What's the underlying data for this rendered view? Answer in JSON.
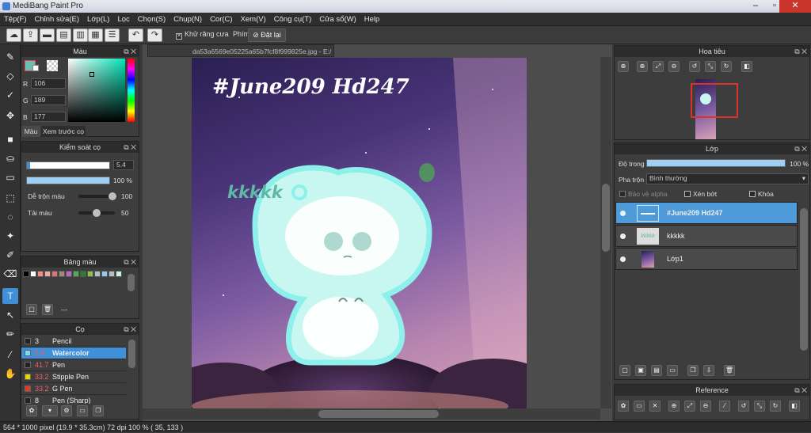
{
  "app": {
    "title": "MediBang Paint Pro"
  },
  "menu": [
    "Tệp(F)",
    "Chỉnh sửa(E)",
    "Lớp(L)",
    "Lọc",
    "Chọn(S)",
    "Chụp(N)",
    "Cor(C)",
    "Xem(V)",
    "Công cụ(T)",
    "Cửa sổ(W)",
    "Help"
  ],
  "toolbar": {
    "antialias_label": "Khử răng cưa",
    "key_label": "Phím",
    "reset_label": "Đặt lại"
  },
  "color_panel": {
    "title": "Màu",
    "r": "106",
    "g": "189",
    "b": "177",
    "r_label": "R",
    "g_label": "G",
    "b_label": "B",
    "tab_color": "Màu",
    "tab_preview": "Xem trước cọ",
    "current_color": "#6abdb1"
  },
  "brush_control": {
    "title": "Kiểm soát cọ",
    "size_value": "5.4",
    "opacity_value": "100 %",
    "blend_label": "Dễ trộn màu",
    "blend_value": "100",
    "resample_label": "Tải màu",
    "resample_value": "50",
    "blend_level": 1.0,
    "resample_level": 0.5
  },
  "palette": {
    "title": "Bảng màu",
    "swatches": [
      "#000000",
      "#ffffff",
      "#f28b82",
      "#f8a5a5",
      "#e57373",
      "#a1887f",
      "#ba68c8",
      "#4caf50",
      "#2e7d32",
      "#8bc34a",
      "#b0bec5",
      "#90caf9",
      "#bdbdbd",
      "#c8f0e8"
    ],
    "name": "---"
  },
  "brush_list": {
    "title": "Cọ",
    "items": [
      {
        "size": "3",
        "name": "Pencil",
        "color": "#222222"
      },
      {
        "size": "5.4",
        "name": "Watercolor",
        "color": "#7ed9f0"
      },
      {
        "size": "41.7",
        "name": "Pen",
        "color": "#222222"
      },
      {
        "size": "33.2",
        "name": "Stipple Pen",
        "color": "#e8d400"
      },
      {
        "size": "33.2",
        "name": "G Pen",
        "color": "#e03a2a"
      },
      {
        "size": "8",
        "name": "Pen (Sharp)",
        "color": "#222222"
      }
    ]
  },
  "document": {
    "tab_title": "da53a6569e05225a65b7fcf8f999825e.jpg - E:/"
  },
  "artwork": {
    "title_text": "#June209 Hd247",
    "kkkkk_text": "kkkkk"
  },
  "navigator": {
    "title": "Hoa tiêu"
  },
  "layers": {
    "title": "Lớp",
    "opacity_label": "Độ trong",
    "opacity_value": "100 %",
    "blend_label": "Pha trộn",
    "blend_value": "Bình thường",
    "protect_alpha": "Bảo vệ alpha",
    "clipping": "Xén bớt",
    "lock": "Khóa",
    "items": [
      {
        "name": "#June209 Hd247",
        "selected": true
      },
      {
        "name": "kkkkk",
        "selected": false
      },
      {
        "name": "Lớp1",
        "selected": false
      }
    ]
  },
  "reference": {
    "title": "Reference"
  },
  "status": {
    "text": "564 * 1000 pixel   (19.9 * 35.3cm)   72 dpi   100 %   ( 35, 133 )"
  }
}
